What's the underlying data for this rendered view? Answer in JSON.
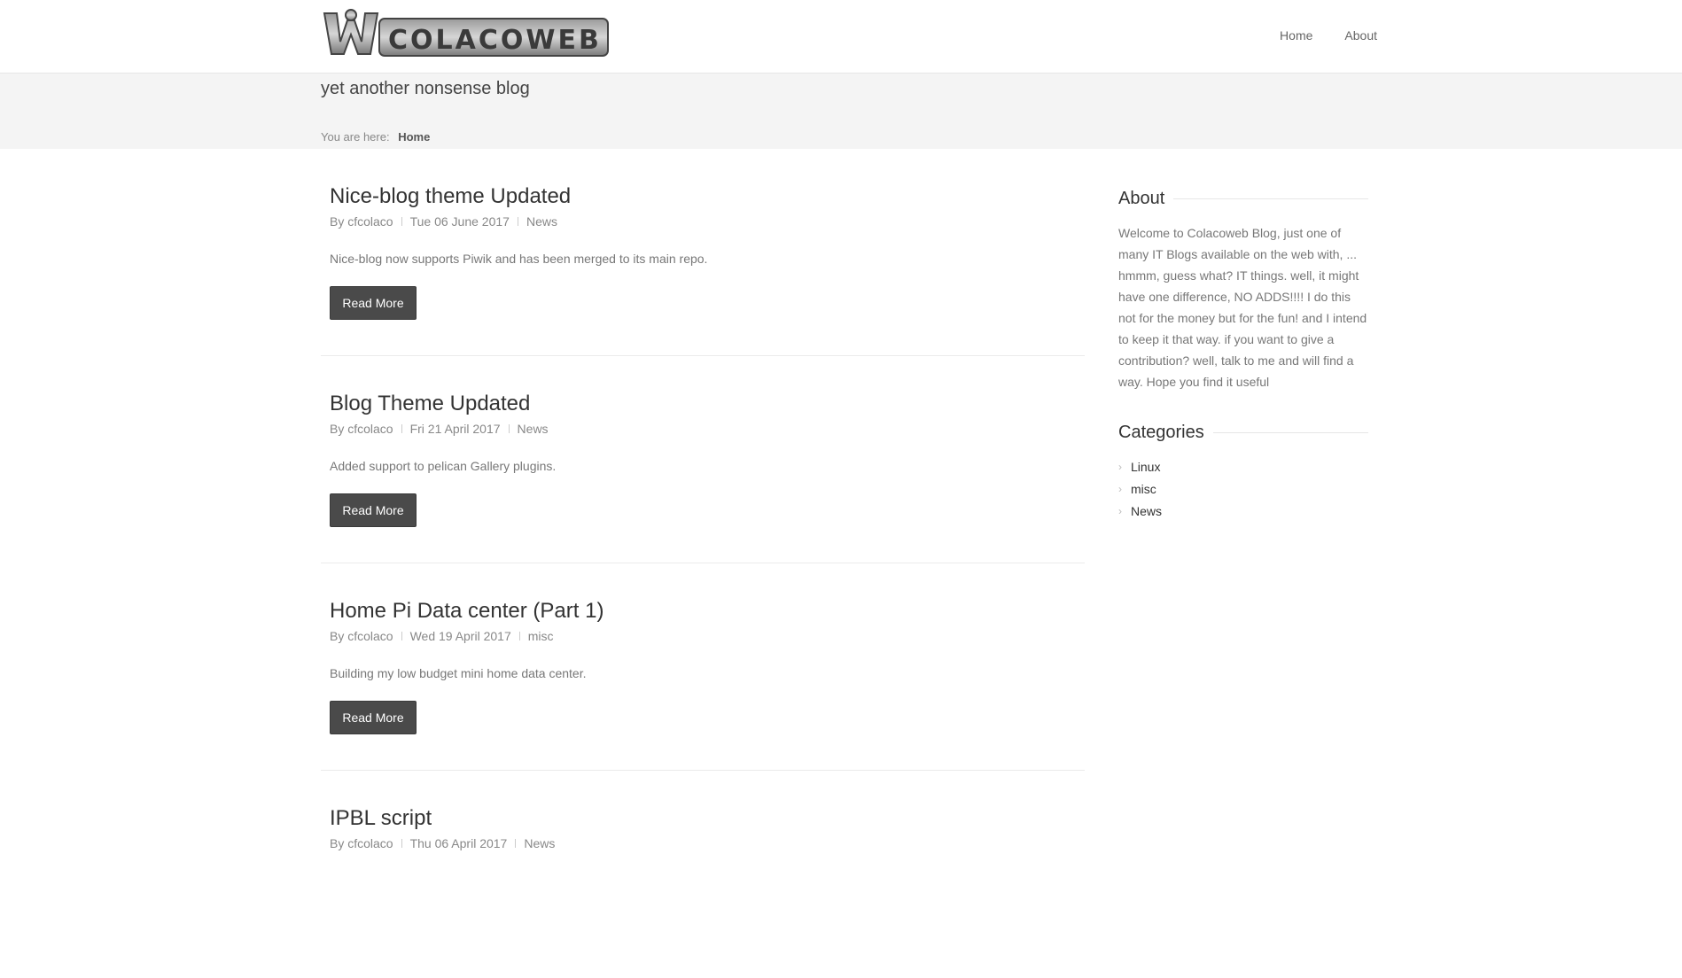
{
  "header": {
    "logo_alt": "COLACOWEB",
    "nav": [
      {
        "label": "Home"
      },
      {
        "label": "About"
      }
    ]
  },
  "tagline": "yet another nonsense blog",
  "breadcrumb": {
    "prefix": "You are here:",
    "current": "Home"
  },
  "posts": [
    {
      "title": "Nice-blog theme Updated",
      "author": "By cfcolaco",
      "date": "Tue 06 June 2017",
      "category": "News",
      "summary": "Nice-blog now supports Piwik and has been merged to its main repo.",
      "button": "Read More"
    },
    {
      "title": "Blog Theme Updated",
      "author": "By cfcolaco",
      "date": "Fri 21 April 2017",
      "category": "News",
      "summary": "Added support to pelican Gallery plugins.",
      "button": "Read More"
    },
    {
      "title": "Home Pi Data center (Part 1)",
      "author": "By cfcolaco",
      "date": "Wed 19 April 2017",
      "category": "misc",
      "summary": "Building my low budget mini home data center.",
      "button": "Read More"
    },
    {
      "title": "IPBL script",
      "author": "By cfcolaco",
      "date": "Thu 06 April 2017",
      "category": "News"
    }
  ],
  "sidebar": {
    "about": {
      "title": "About",
      "text": "Welcome to Colacoweb Blog, just one of many IT Blogs available on the web with, ... hmmm, guess what? IT things. well, it might have one difference, NO ADDS!!!! I do this not for the money but for the fun! and I intend to keep it that way. if you want to give a contribution? well, talk to me and will find a way. Hope you find it useful"
    },
    "categories": {
      "title": "Categories",
      "items": [
        {
          "label": "Linux"
        },
        {
          "label": "misc"
        },
        {
          "label": "News"
        }
      ]
    }
  },
  "icons": {
    "separator": "meta-separator-icon",
    "chevron": "chevron-right-icon"
  },
  "colors": {
    "button_bg": "#4a4a4a",
    "band_bg": "#f4f4f4"
  }
}
